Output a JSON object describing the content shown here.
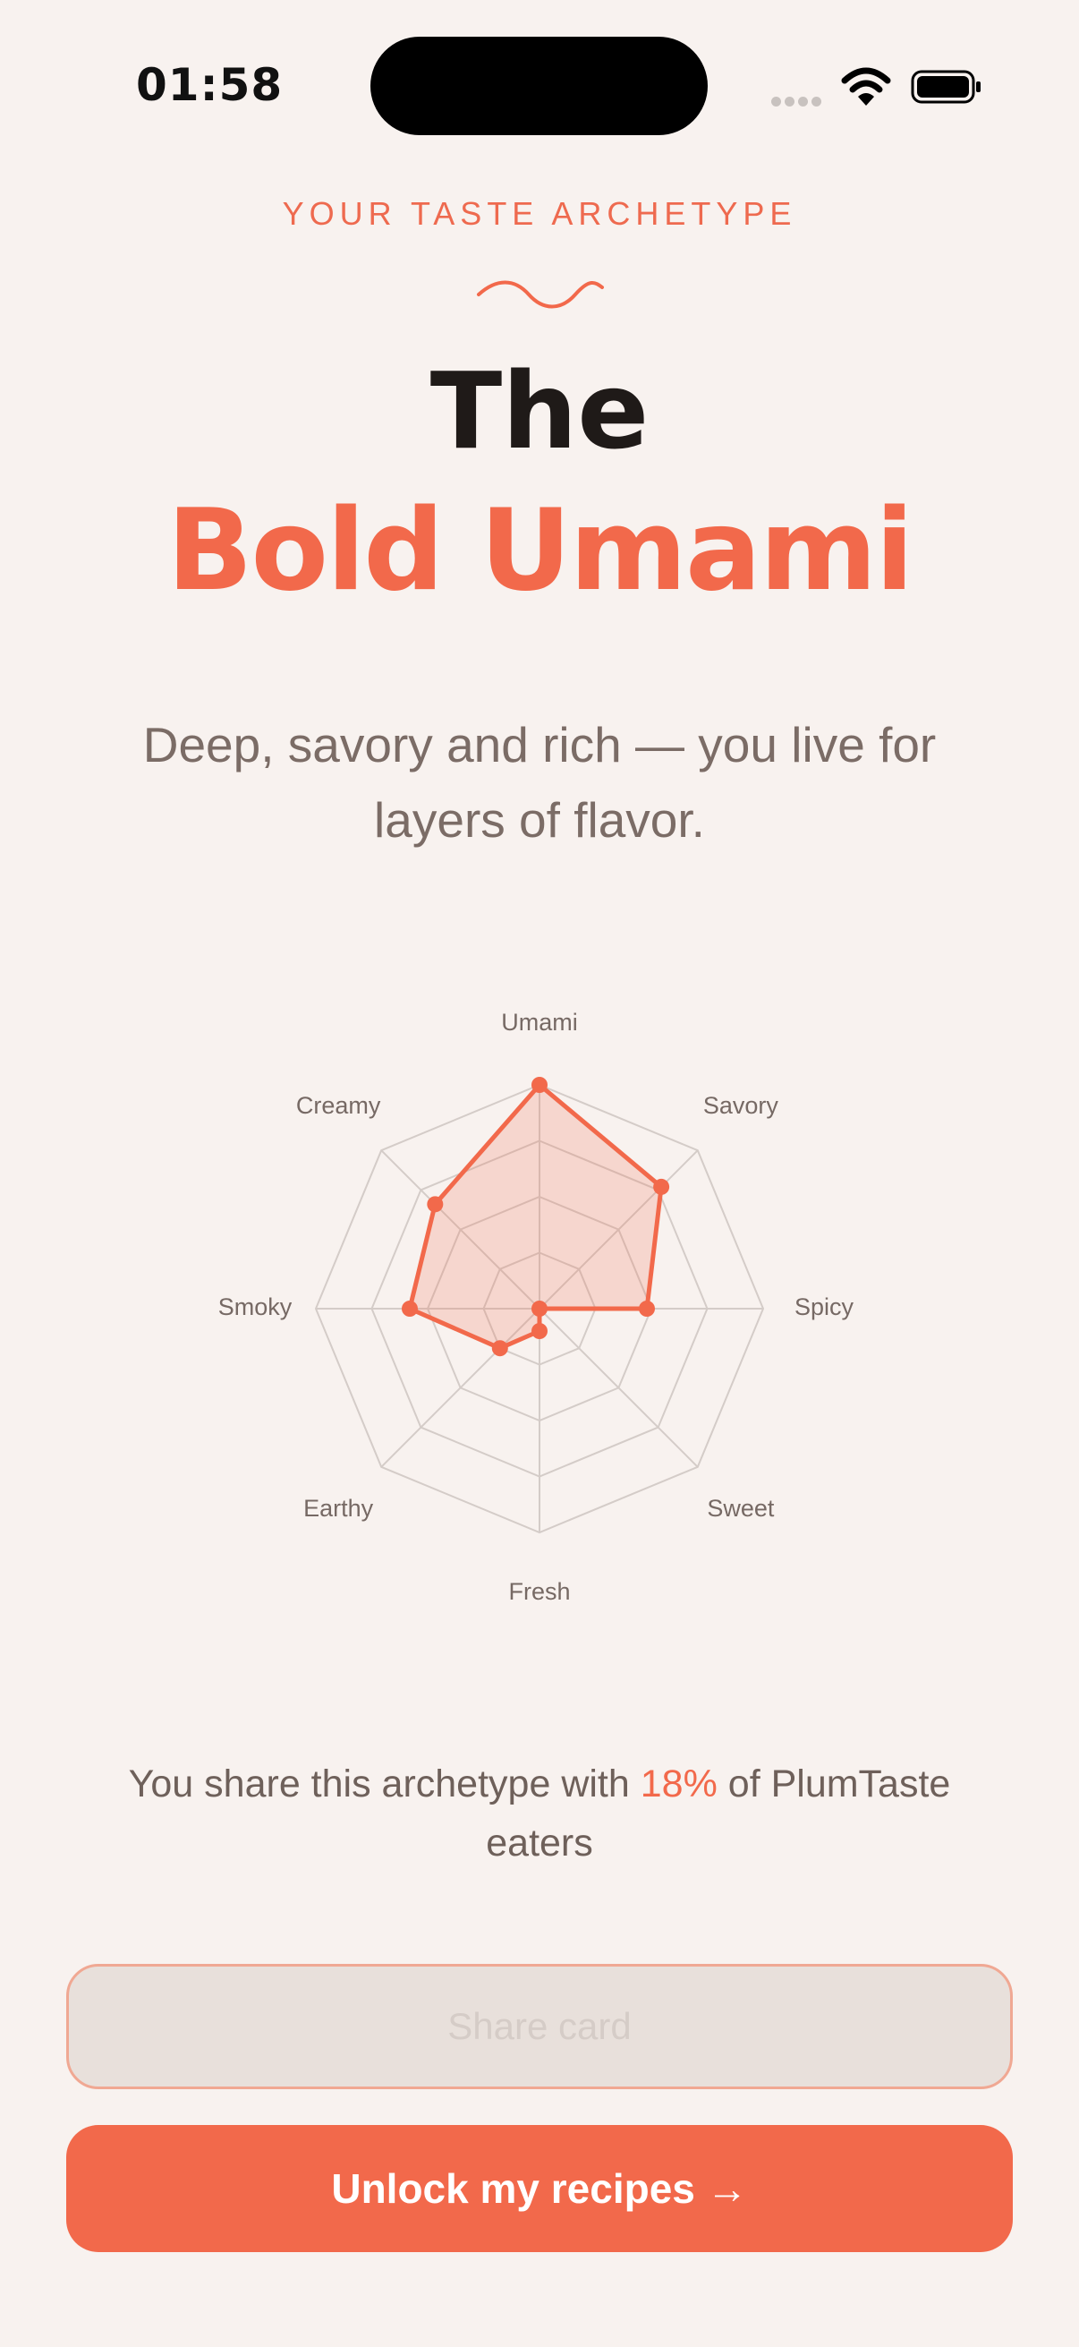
{
  "status_bar": {
    "time": "01:58"
  },
  "header": {
    "eyebrow": "YOUR TASTE ARCHETYPE",
    "title_prefix": "The",
    "title_main": "Bold Umami",
    "subtitle": "Deep, savory and rich — you live for layers of flavor."
  },
  "chart_data": {
    "type": "radar",
    "axes": [
      "Umami",
      "Savory",
      "Spicy",
      "Sweet",
      "Fresh",
      "Earthy",
      "Smoky",
      "Creamy"
    ],
    "values": [
      1.0,
      0.77,
      0.48,
      0.0,
      0.1,
      0.25,
      0.58,
      0.66
    ],
    "range": [
      0,
      1
    ],
    "rings": 4,
    "colors": {
      "series": "#f2694b",
      "grid": "#d4ccc8"
    }
  },
  "share": {
    "prefix": "You share this archetype with ",
    "percent": "18%",
    "suffix": " of PlumTaste eaters"
  },
  "buttons": {
    "share_label": "Share card",
    "unlock_label": "Unlock my recipes →"
  },
  "colors": {
    "accent": "#f2694b",
    "background": "#f8f2ef",
    "text_dark": "#1f1a18",
    "text_muted": "#7b6c66"
  }
}
